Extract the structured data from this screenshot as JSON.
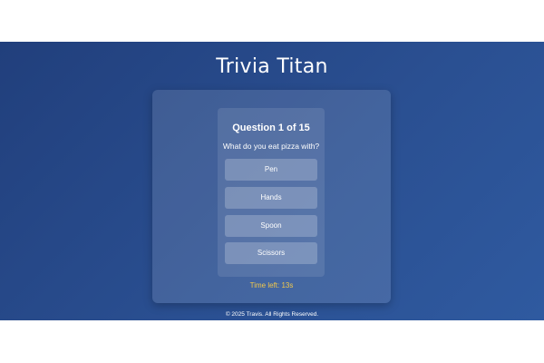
{
  "header": {
    "title": "Trivia Titan"
  },
  "quiz": {
    "question_count": "Question 1 of 15",
    "question": "What do you eat pizza with?",
    "answers": [
      "Pen",
      "Hands",
      "Spoon",
      "Scissors"
    ],
    "timer": "Time left: 13s"
  },
  "footer": {
    "text": "© 2025 Travis. All Rights Reserved."
  },
  "colors": {
    "background": "#2a4f91",
    "timer": "#f2c84b"
  }
}
